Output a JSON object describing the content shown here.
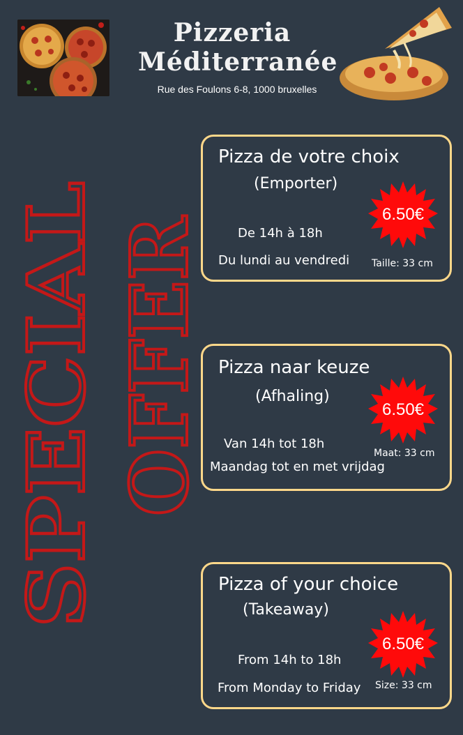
{
  "header": {
    "title_line1": "Pizzeria",
    "title_line2": "Méditerranée",
    "address": "Rue des Foulons 6-8, 1000 bruxelles"
  },
  "banner": {
    "text_line1": "SPECIAL",
    "text_line2": "OFFER",
    "color": "#c41818"
  },
  "colors": {
    "background": "#2f3a46",
    "card_border": "#ffd88a",
    "burst": "#ff0a0a"
  },
  "offers": [
    {
      "title": "Pizza de votre choix",
      "subtitle": "(Emporter)",
      "price": "6.50€",
      "hours": "De 14h à 18h",
      "days": "Du lundi au vendredi",
      "size": "Taille: 33 cm"
    },
    {
      "title": "Pizza naar keuze",
      "subtitle": "(Afhaling)",
      "price": "6.50€",
      "hours": "Van 14h tot 18h",
      "days": "Maandag tot en met vrijdag",
      "size": "Maat: 33 cm"
    },
    {
      "title": "Pizza of your choice",
      "subtitle": "(Takeaway)",
      "price": "6.50€",
      "hours": "From 14h to 18h",
      "days": "From Monday to Friday",
      "size": "Size: 33 cm"
    }
  ]
}
